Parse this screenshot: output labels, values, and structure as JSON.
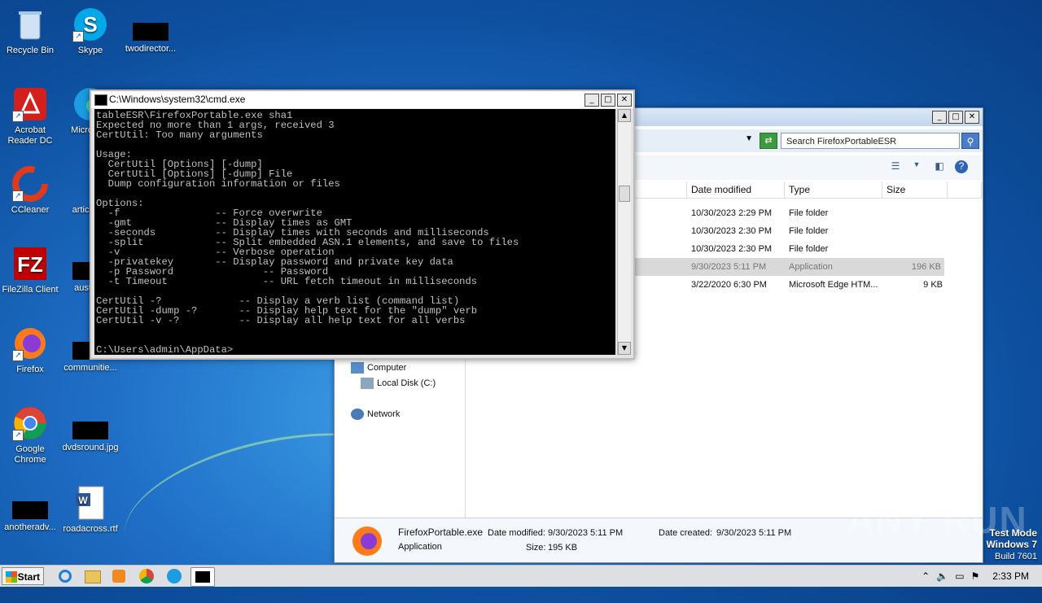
{
  "desktop": {
    "icons": [
      {
        "label": "Recycle Bin"
      },
      {
        "label": "Skype"
      },
      {
        "label": "twodirector..."
      },
      {
        "label": "Acrobat Reader DC"
      },
      {
        "label": "Microso..."
      },
      {
        "label": "CCleaner"
      },
      {
        "label": "articleb..."
      },
      {
        "label": "FileZilla Client"
      },
      {
        "label": "austra..."
      },
      {
        "label": "Firefox"
      },
      {
        "label": "communitie..."
      },
      {
        "label": "Google Chrome"
      },
      {
        "label": "dvdsround.jpg"
      },
      {
        "label": "anotheradv..."
      },
      {
        "label": "roadacross.rtf"
      }
    ]
  },
  "cmd": {
    "title": "C:\\Windows\\system32\\cmd.exe",
    "output": "tableESR\\FirefoxPortable.exe sha1\nExpected no more than 1 args, received 3\nCertUtil: Too many arguments\n\nUsage:\n  CertUtil [Options] [-dump]\n  CertUtil [Options] [-dump] File\n  Dump configuration information or files\n\nOptions:\n  -f                -- Force overwrite\n  -gmt              -- Display times as GMT\n  -seconds          -- Display times with seconds and milliseconds\n  -split            -- Split embedded ASN.1 elements, and save to files\n  -v                -- Verbose operation\n  -privatekey       -- Display password and private key data\n  -p Password               -- Password\n  -t Timeout                -- URL fetch timeout in milliseconds\n\nCertUtil -?             -- Display a verb list (command list)\nCertUtil -dump -?       -- Display help text for the \"dump\" verb\nCertUtil -v -?          -- Display all help text for all verbs\n\n\nC:\\Users\\admin\\AppData>"
  },
  "explorer": {
    "search_placeholder": "Search FirefoxPortableESR",
    "columns": {
      "date": "Date modified",
      "type": "Type",
      "size": "Size"
    },
    "rows": [
      {
        "date": "10/30/2023 2:29 PM",
        "type": "File folder",
        "size": ""
      },
      {
        "date": "10/30/2023 2:30 PM",
        "type": "File folder",
        "size": ""
      },
      {
        "date": "10/30/2023 2:30 PM",
        "type": "File folder",
        "size": ""
      },
      {
        "date": "9/30/2023 5:11 PM",
        "type": "Application",
        "size": "196 KB"
      },
      {
        "date": "3/22/2020 6:30 PM",
        "type": "Microsoft Edge HTM...",
        "size": "9 KB"
      }
    ],
    "nav": {
      "computer": "Computer",
      "local_disk": "Local Disk (C:)",
      "network": "Network"
    },
    "details": {
      "name": "FirefoxPortable.exe",
      "kind": "Application",
      "modified_label": "Date modified:",
      "modified": "9/30/2023 5:11 PM",
      "created_label": "Date created:",
      "created": "9/30/2023 5:11 PM",
      "size_label": "Size:",
      "size": "195 KB"
    }
  },
  "watermark": "ANY RUN",
  "os_info": {
    "line1": "Test Mode",
    "line2": "Windows 7",
    "line3": "Build 7601"
  },
  "taskbar": {
    "start_label": "Start",
    "clock": "2:33 PM"
  }
}
